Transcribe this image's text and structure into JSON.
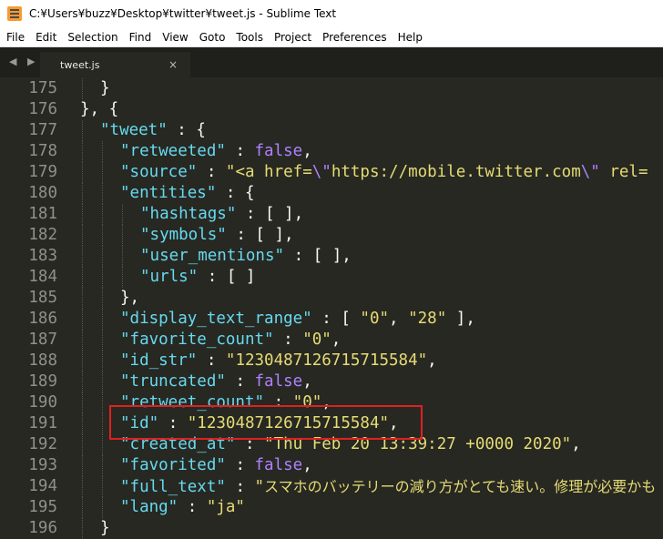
{
  "window": {
    "title": "C:¥Users¥buzz¥Desktop¥twitter¥tweet.js - Sublime Text"
  },
  "menu": [
    "File",
    "Edit",
    "Selection",
    "Find",
    "View",
    "Goto",
    "Tools",
    "Project",
    "Preferences",
    "Help"
  ],
  "tabs": {
    "nav_arrows": "◀ ▶",
    "active": "tweet.js",
    "close": "×"
  },
  "editor": {
    "lines": [
      {
        "n": "175",
        "depth": 1,
        "tokens": [
          [
            "p",
            "}"
          ]
        ]
      },
      {
        "n": "176",
        "depth": 0,
        "tokens": [
          [
            "p",
            "}, {"
          ]
        ]
      },
      {
        "n": "177",
        "depth": 1,
        "tokens": [
          [
            "k",
            "\"tweet\""
          ],
          [
            "p",
            " : {"
          ]
        ]
      },
      {
        "n": "178",
        "depth": 2,
        "tokens": [
          [
            "k",
            "\"retweeted\""
          ],
          [
            "p",
            " : "
          ],
          [
            "bool",
            "false"
          ],
          [
            "p",
            ","
          ]
        ]
      },
      {
        "n": "179",
        "depth": 2,
        "tokens": [
          [
            "k",
            "\"source\""
          ],
          [
            "p",
            " : "
          ],
          [
            "s",
            "\"<a href="
          ],
          [
            "esc",
            "\\\""
          ],
          [
            "s",
            "https://mobile.twitter.com"
          ],
          [
            "esc",
            "\\\""
          ],
          [
            "s",
            " rel="
          ]
        ]
      },
      {
        "n": "180",
        "depth": 2,
        "tokens": [
          [
            "k",
            "\"entities\""
          ],
          [
            "p",
            " : {"
          ]
        ]
      },
      {
        "n": "181",
        "depth": 3,
        "tokens": [
          [
            "k",
            "\"hashtags\""
          ],
          [
            "p",
            " : [ ],"
          ]
        ]
      },
      {
        "n": "182",
        "depth": 3,
        "tokens": [
          [
            "k",
            "\"symbols\""
          ],
          [
            "p",
            " : [ ],"
          ]
        ]
      },
      {
        "n": "183",
        "depth": 3,
        "tokens": [
          [
            "k",
            "\"user_mentions\""
          ],
          [
            "p",
            " : [ ],"
          ]
        ]
      },
      {
        "n": "184",
        "depth": 3,
        "tokens": [
          [
            "k",
            "\"urls\""
          ],
          [
            "p",
            " : [ ]"
          ]
        ]
      },
      {
        "n": "185",
        "depth": 2,
        "tokens": [
          [
            "p",
            "},"
          ]
        ]
      },
      {
        "n": "186",
        "depth": 2,
        "tokens": [
          [
            "k",
            "\"display_text_range\""
          ],
          [
            "p",
            " : [ "
          ],
          [
            "s",
            "\"0\""
          ],
          [
            "p",
            ", "
          ],
          [
            "s",
            "\"28\""
          ],
          [
            "p",
            " ],"
          ]
        ]
      },
      {
        "n": "187",
        "depth": 2,
        "tokens": [
          [
            "k",
            "\"favorite_count\""
          ],
          [
            "p",
            " : "
          ],
          [
            "s",
            "\"0\""
          ],
          [
            "p",
            ","
          ]
        ]
      },
      {
        "n": "188",
        "depth": 2,
        "tokens": [
          [
            "k",
            "\"id_str\""
          ],
          [
            "p",
            " : "
          ],
          [
            "s",
            "\"1230487126715715584\""
          ],
          [
            "p",
            ","
          ]
        ]
      },
      {
        "n": "189",
        "depth": 2,
        "tokens": [
          [
            "k",
            "\"truncated\""
          ],
          [
            "p",
            " : "
          ],
          [
            "bool",
            "false"
          ],
          [
            "p",
            ","
          ]
        ]
      },
      {
        "n": "190",
        "depth": 2,
        "tokens": [
          [
            "k",
            "\"retweet_count\""
          ],
          [
            "p",
            " : "
          ],
          [
            "s",
            "\"0\""
          ],
          [
            "p",
            ","
          ]
        ]
      },
      {
        "n": "191",
        "depth": 2,
        "tokens": [
          [
            "k",
            "\"id\""
          ],
          [
            "p",
            " : "
          ],
          [
            "s",
            "\"1230487126715715584\""
          ],
          [
            "p",
            ","
          ]
        ]
      },
      {
        "n": "192",
        "depth": 2,
        "tokens": [
          [
            "k",
            "\"created_at\""
          ],
          [
            "p",
            " : "
          ],
          [
            "s",
            "\"Thu Feb 20 13:39:27 +0000 2020\""
          ],
          [
            "p",
            ","
          ]
        ]
      },
      {
        "n": "193",
        "depth": 2,
        "tokens": [
          [
            "k",
            "\"favorited\""
          ],
          [
            "p",
            " : "
          ],
          [
            "bool",
            "false"
          ],
          [
            "p",
            ","
          ]
        ]
      },
      {
        "n": "194",
        "depth": 2,
        "tokens": [
          [
            "k",
            "\"full_text\""
          ],
          [
            "p",
            " : "
          ],
          [
            "s",
            "\""
          ],
          [
            "sj",
            "スマホのバッテリーの減り方がとても速い。修理が必要かも"
          ]
        ]
      },
      {
        "n": "195",
        "depth": 2,
        "tokens": [
          [
            "k",
            "\"lang\""
          ],
          [
            "p",
            " : "
          ],
          [
            "s",
            "\"ja\""
          ]
        ]
      },
      {
        "n": "196",
        "depth": 1,
        "tokens": [
          [
            "p",
            "}"
          ]
        ]
      }
    ]
  },
  "colors": {
    "background": "#272822",
    "key": "#66d9ef",
    "string": "#e6db74",
    "boolean": "#ae81ff",
    "plain": "#f8f8f2",
    "line_number": "#90908a",
    "highlight_box": "#e02020"
  }
}
